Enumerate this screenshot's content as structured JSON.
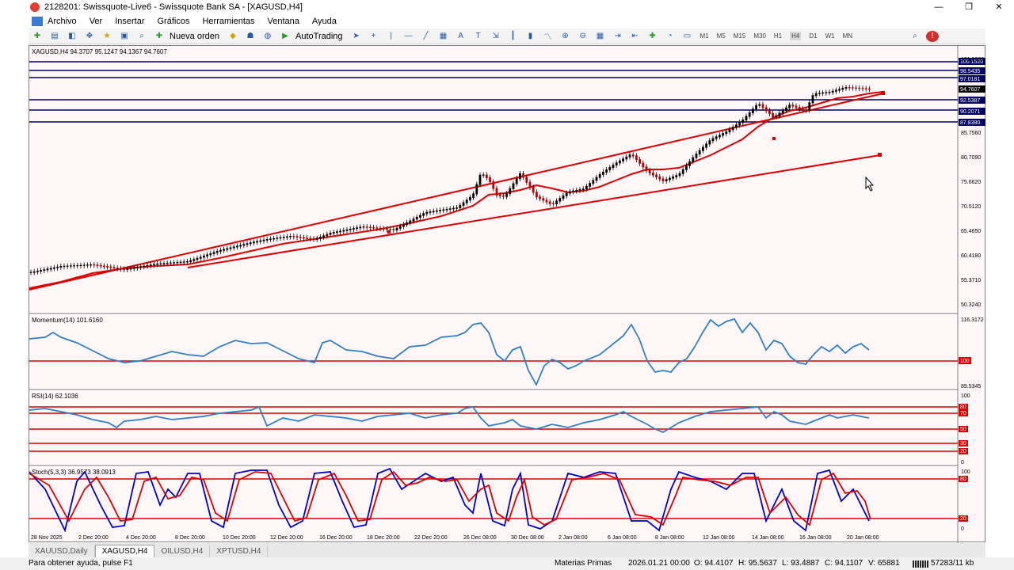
{
  "window": {
    "title": "2128201: Swissquote-Live6 - Swissquote Bank SA - [XAGUSD,H4]",
    "controls": [
      "—",
      "❐",
      "✕"
    ]
  },
  "menu": [
    "Archivo",
    "Ver",
    "Insertar",
    "Gráficos",
    "Herramientas",
    "Ventana",
    "Ayuda"
  ],
  "toolbar": {
    "new_order": "Nueva orden",
    "autotrading": "AutoTrading",
    "timeframes": [
      "M1",
      "M5",
      "M15",
      "M30",
      "H1",
      "H4",
      "D1",
      "W1",
      "MN"
    ],
    "active_timeframe": "H4"
  },
  "chart": {
    "info": "XAGUSD,H4  94.3707 95.1247 94.1367 94.7607",
    "price_labels": [
      "101.0000",
      "85.7560",
      "80.7090",
      "75.6620",
      "70.5120",
      "65.4650",
      "60.4180",
      "55.3710",
      "50.3240"
    ],
    "line_labels": [
      "100.1520",
      "98.5435",
      "97.0181",
      "94.7607",
      "92.5387",
      "90.2071",
      "87.8380"
    ],
    "momentum_label": "Momentum(14) 101.6160",
    "momentum_scale": [
      "116.3172",
      "100",
      "89.5345"
    ],
    "rsi_label": "RSI(14) 62.1036",
    "rsi_scale": [
      "100",
      "80",
      "70",
      "50",
      "30",
      "20",
      "0"
    ],
    "stoch_label": "Stoch(5,3,3) 36.9573 38.0913",
    "stoch_scale": [
      "100",
      "80",
      "20",
      "0"
    ],
    "dates": [
      "28 Nov 2025",
      "2 Dec 20:00",
      "4 Dec 20:00",
      "8 Dec 20:00",
      "10 Dec 20:00",
      "12 Dec 20:00",
      "16 Dec 20:00",
      "18 Dec 20:00",
      "22 Dec 20:00",
      "26 Dec 08:00",
      "30 Dec 08:00",
      "2 Jan 08:00",
      "6 Jan 08:00",
      "8 Jan 08:00",
      "12 Jan 08:00",
      "14 Jan 08:00",
      "16 Jan 08:00",
      "20 Jan 08:00"
    ]
  },
  "tabs": [
    "XAUUSD,Daily",
    "XAGUSD,H4",
    "OILUSD,H4",
    "XPTUSD,H4"
  ],
  "active_tab": "XAGUSD,H4",
  "status": {
    "help": "Para obtener ayuda, pulse F1",
    "profile": "Materias Primas",
    "datetime": "2026.01.21 00:00",
    "open": "O: 94.4107",
    "high": "H: 95.5637",
    "low": "L: 93.4887",
    "close": "C: 94.1107",
    "volume": "V: 65881",
    "traffic": "57283/11 kb"
  },
  "colors": {
    "chart_bg": "#fff6f8",
    "line_red": "#dd0000",
    "line_navy": "#000060",
    "indicator_blue": "#2f7fc6",
    "stoch_blue": "#0000cc"
  }
}
